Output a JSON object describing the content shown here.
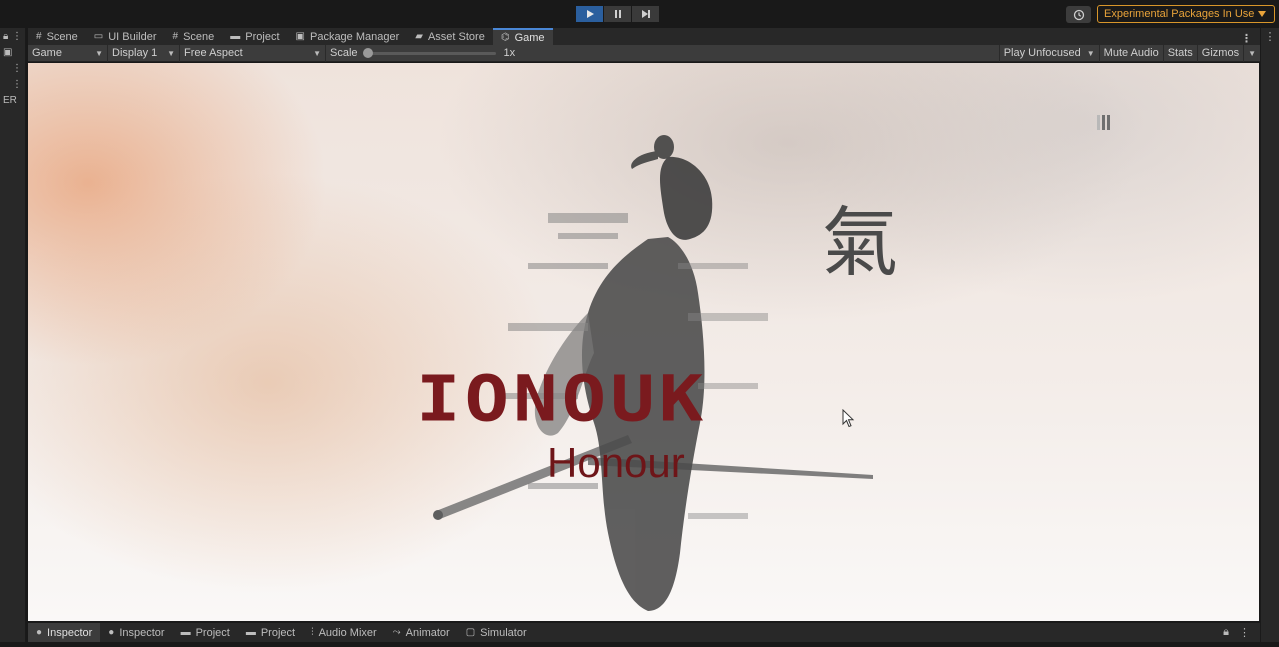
{
  "toolbar": {
    "play_icon": "play-icon",
    "pause_icon": "pause-icon",
    "step_icon": "step-icon",
    "history_icon": "history-icon",
    "experimental_label": "Experimental Packages In Use",
    "experimental_color": "#e8a33a"
  },
  "left_strip": {
    "label": "ER"
  },
  "tabs": [
    {
      "label": "Scene",
      "icon": "grid-icon"
    },
    {
      "label": "UI Builder",
      "icon": "ui-builder-icon"
    },
    {
      "label": "Scene",
      "icon": "grid-icon"
    },
    {
      "label": "Project",
      "icon": "folder-icon"
    },
    {
      "label": "Package Manager",
      "icon": "package-icon"
    },
    {
      "label": "Asset Store",
      "icon": "bag-icon"
    },
    {
      "label": "Game",
      "icon": "gamepad-icon",
      "active": true
    }
  ],
  "gamebar": {
    "view": "Game",
    "display": "Display 1",
    "aspect": "Free Aspect",
    "scale_label": "Scale",
    "scale_value": "1x",
    "scale_fraction": 0,
    "play_mode": "Play Unfocused",
    "mute": "Mute Audio",
    "stats": "Stats",
    "gizmos": "Gizmos"
  },
  "game": {
    "title": "IONOUK",
    "subtitle": "Honour",
    "kanji": "氣",
    "title_color": "#7a1a1e",
    "pause_icon": "pause-icon"
  },
  "bottom_tabs": [
    {
      "label": "Inspector",
      "icon": "info-icon",
      "active": true
    },
    {
      "label": "Inspector",
      "icon": "info-icon"
    },
    {
      "label": "Project",
      "icon": "folder-icon"
    },
    {
      "label": "Project",
      "icon": "folder-icon"
    },
    {
      "label": "Audio Mixer",
      "icon": "mixer-icon"
    },
    {
      "label": "Animator",
      "icon": "animator-icon"
    },
    {
      "label": "Simulator",
      "icon": "simulator-icon"
    }
  ],
  "bottom_right": {
    "lock_icon": "lock-icon",
    "menu_icon": "kebab-menu-icon"
  }
}
